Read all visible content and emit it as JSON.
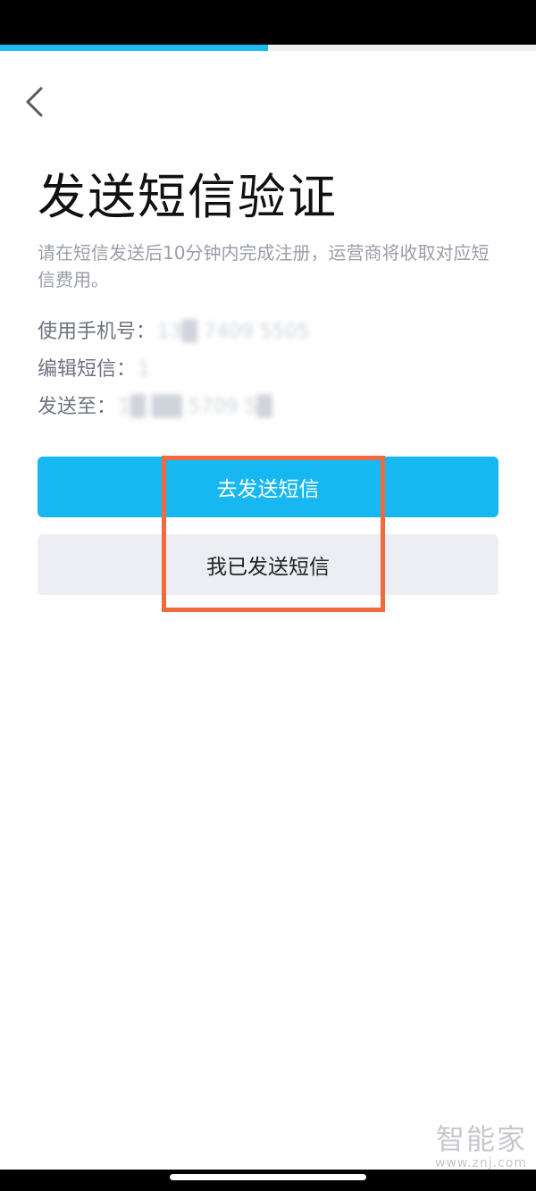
{
  "progress": {
    "fraction": 0.5,
    "color": "#1dbaf1"
  },
  "nav": {
    "back_icon": "chevron-left-icon"
  },
  "page": {
    "title": "发送短信验证",
    "description": "请在短信发送后10分钟内完成注册，运营商将收取对应短信费用。"
  },
  "info": {
    "phone_label": "使用手机号：",
    "phone_value": "13█ 7409 5505",
    "sms_label": "编辑短信：",
    "sms_value": "1",
    "send_to_label": "发送至：",
    "send_to_value": "1█ ██ 5709 5█"
  },
  "buttons": {
    "send_sms": "去发送短信",
    "sent_sms": "我已发送短信"
  },
  "watermark": {
    "main": "智能家",
    "sub": "www.znj.com"
  },
  "colors": {
    "accent": "#17b7f2",
    "highlight": "#ef6b3e",
    "secondary_button": "#eceef3"
  }
}
